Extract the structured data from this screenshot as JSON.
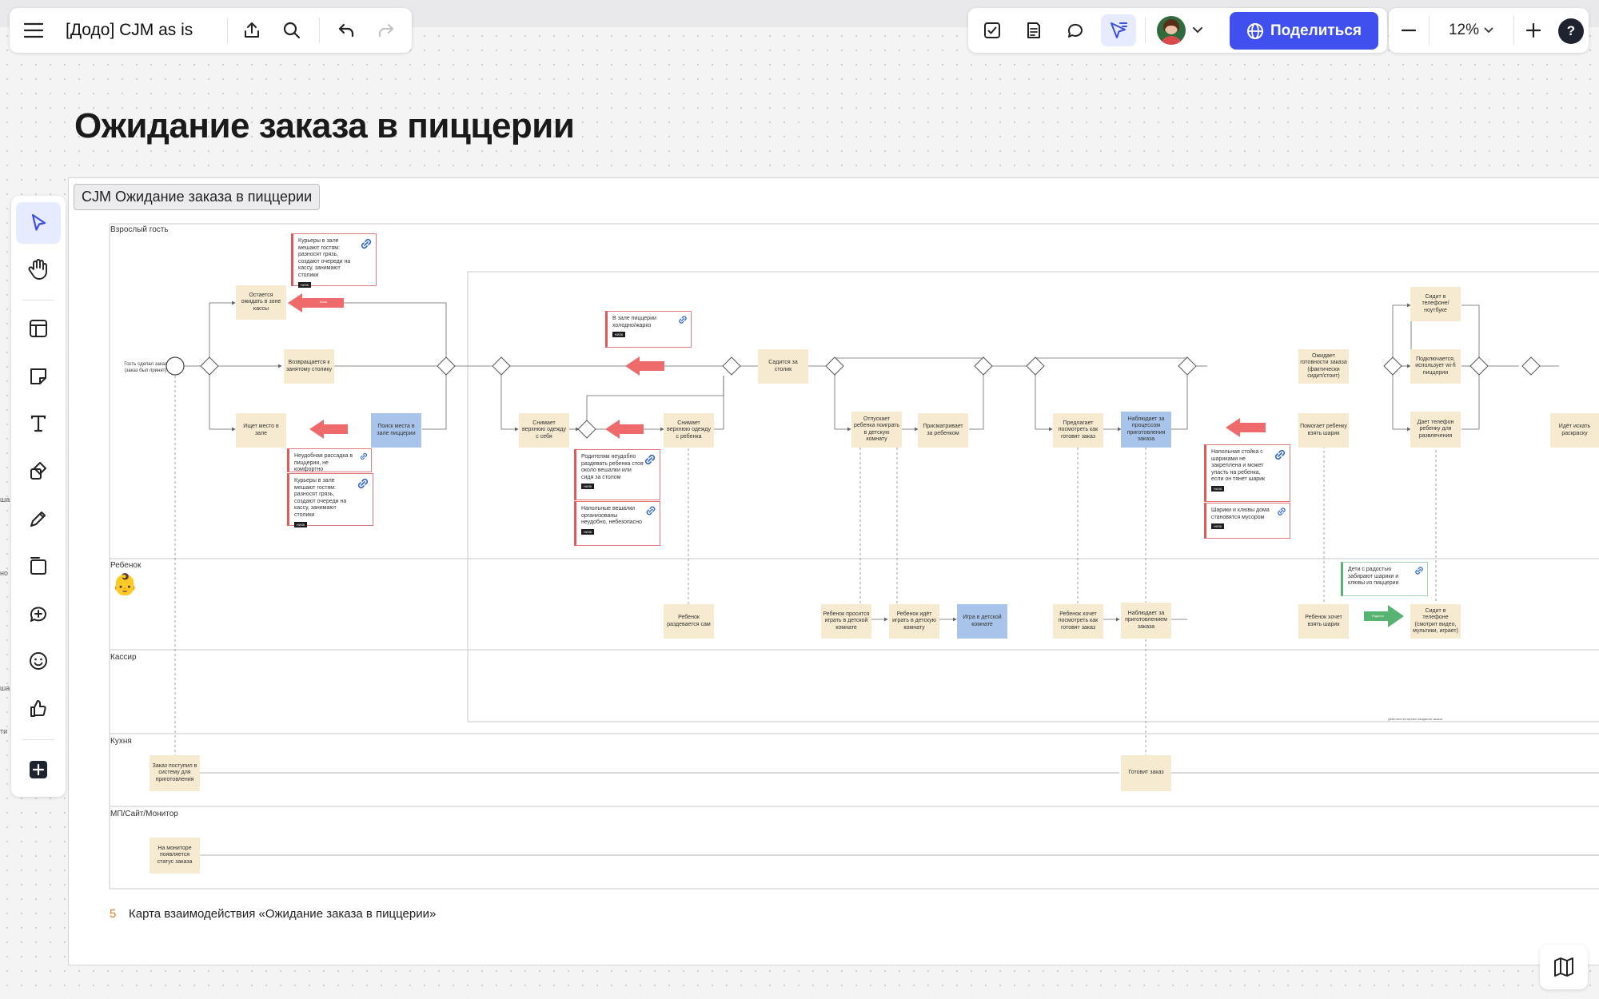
{
  "toolbar": {
    "menu_icon": "hamburger-icon",
    "board_name": "[Додо] CJM as is",
    "share_label": "Поделиться",
    "zoom_level": "12%",
    "help_label": "?"
  },
  "board_title": "Ожидание заказа в пиццерии",
  "frame_label": "CJM Ожидание заказа в пиццерии",
  "lanes": {
    "adult": "Взрослый гость",
    "child": "Ребенок",
    "child_emoji": "👶",
    "cashier": "Кассир",
    "kitchen": "Кухня",
    "monitor": "МП/Сайт/Монитор"
  },
  "left_edge_fragments": [
    "ша",
    "но",
    "ша",
    "ти"
  ],
  "notes": {
    "start": "Гость сделал заказ (заказ был принят)",
    "stay_cash": "Остается ожидать в зоне кассы",
    "return_table": "Возвращается к занятому столику",
    "find_seat": "Ищет место в зале",
    "search_seat": "Поиск места в зале пиццерии",
    "remove_self": "Снимает верхнюю одежду с себя",
    "remove_child": "Снимает верхнюю одежду с ребенка",
    "sit_table": "Садится за столик",
    "let_child": "Отпускает ребенка поиграть в детскую комнату",
    "watch_child": "Присматривает за ребенком",
    "offer_look": "Предлагает посмотреть как готовят заказ",
    "observe_cook": "Наблюдает за процессом приготовления заказа",
    "wait_ready": "Ожидает готовности заказа (фактически сидит/стоит)",
    "help_balloon": "Помогает ребенку взять шарик",
    "sits_phone": "Сидит в телефоне/ноутбуке",
    "wifi": "Подключается, использует wi-fi пиццерии",
    "give_phone": "Дает телефон ребенку для развлечения",
    "coloring": "Идёт искать раскраску",
    "child_dress": "Ребенок раздевается сам",
    "child_asks": "Ребенок просится играть в детской комнате",
    "child_goes": "Ребенок идёт играть в детскую комнату",
    "play_room": "Игра в детской комнате",
    "child_wants_look": "Ребенок хочет посмотреть как готовят заказ",
    "child_observes": "Наблюдает за приготовлением заказа",
    "child_balloon": "Ребенок хочет взять шарик",
    "child_phone": "Сидит в телефоне (смотрит видео, мультики, играет)",
    "order_received": "Заказ поступил в систему для приготовления",
    "cooking": "Готовит заказ",
    "monitor_status": "На мониторе появляется статус заказа"
  },
  "pain_points": {
    "couriers_top": "Курьеры в зале мешают гостям: разносят грязь, создают очереди на кассу, занимают столики",
    "cold_hot": "В зале пиццерии холодно/жарко",
    "seating": "Неудобная рассадка в пиццерии, не комфортно",
    "couriers_bottom": "Курьеры в зале мешают гостям: разносят грязь, создают очереди на кассу, занимают столики",
    "parents_hanger": "Родителям неудобно раздевать ребенка стоя около вешалки или сидя за столом",
    "floor_hangers": "Напольные вешалки организованы неудобно, небезопасно",
    "balloon_stand": "Напольная стойка с шариками не закреплена и может упасть на ребенка, если он тянет шарик",
    "balloon_trash": "Шарики и клювы дома становятся мусором",
    "tag_text": "НИЗК"
  },
  "positive_note": "Дети с радостью забирают шарики и клювы из пиццерии",
  "arrow_labels": {
    "pain": "Боль",
    "positive": "Радость"
  },
  "tiny_caption": "Действия во время ожидания заказа",
  "footer": {
    "number": "5",
    "caption": "Карта взаимодействия «Ожидание заказа в пиццерии»"
  },
  "colors": {
    "accent": "#4050ef",
    "note": "#f6ead0",
    "note_blue": "#a9c4ea",
    "pain": "#ef6b6b",
    "positive": "#56b372"
  }
}
